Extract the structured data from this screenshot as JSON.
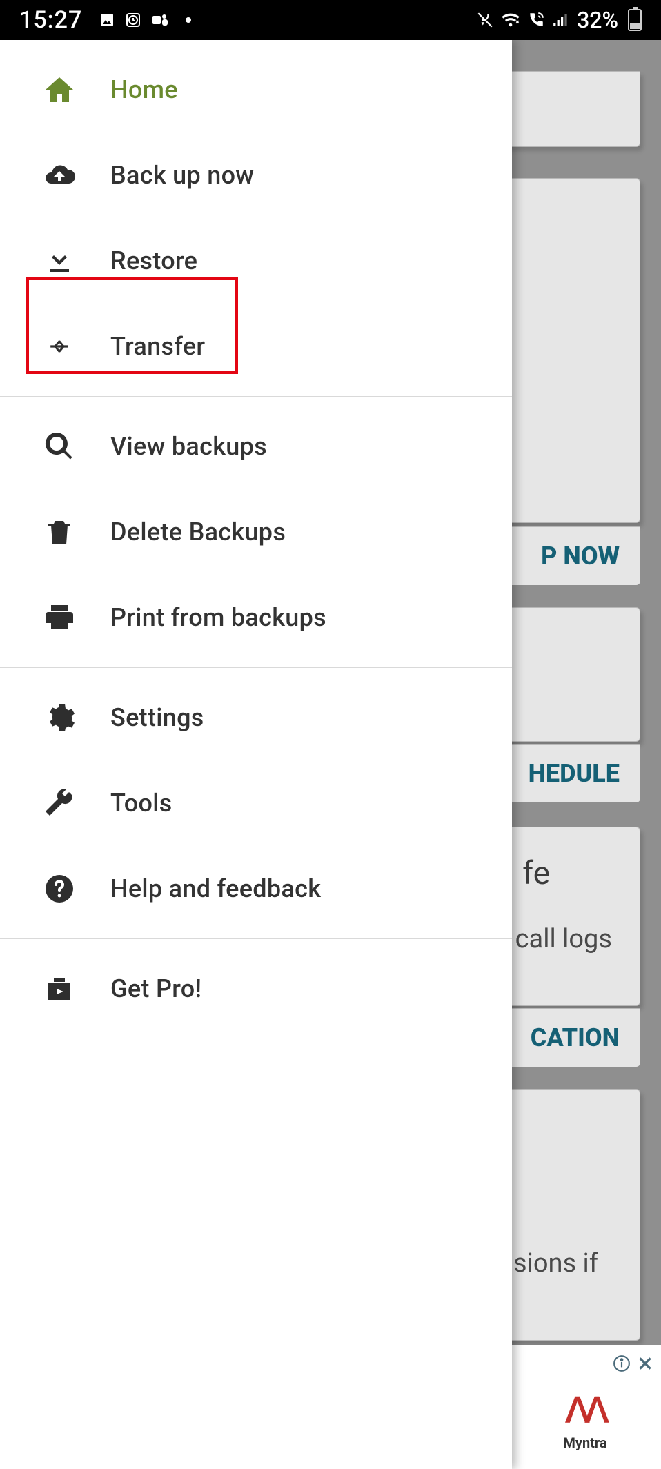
{
  "status": {
    "time": "15:27",
    "battery_pct": "32%"
  },
  "drawer": {
    "items": [
      {
        "label": "Home",
        "active": true
      },
      {
        "label": "Back up now",
        "active": false
      },
      {
        "label": "Restore",
        "active": false
      },
      {
        "label": "Transfer",
        "active": false
      },
      {
        "label": "View backups",
        "active": false
      },
      {
        "label": "Delete Backups",
        "active": false
      },
      {
        "label": "Print from backups",
        "active": false
      },
      {
        "label": "Settings",
        "active": false
      },
      {
        "label": "Tools",
        "active": false
      },
      {
        "label": "Help and feedback",
        "active": false
      },
      {
        "label": "Get Pro!",
        "active": false
      }
    ]
  },
  "bg": {
    "btn_backup": "P NOW",
    "btn_schedule": "HEDULE",
    "title_safe": "fe",
    "text_calllogs": "call logs",
    "btn_location": "CATION",
    "text_permissions": "sions if"
  },
  "ad": {
    "brand": "Myntra"
  }
}
